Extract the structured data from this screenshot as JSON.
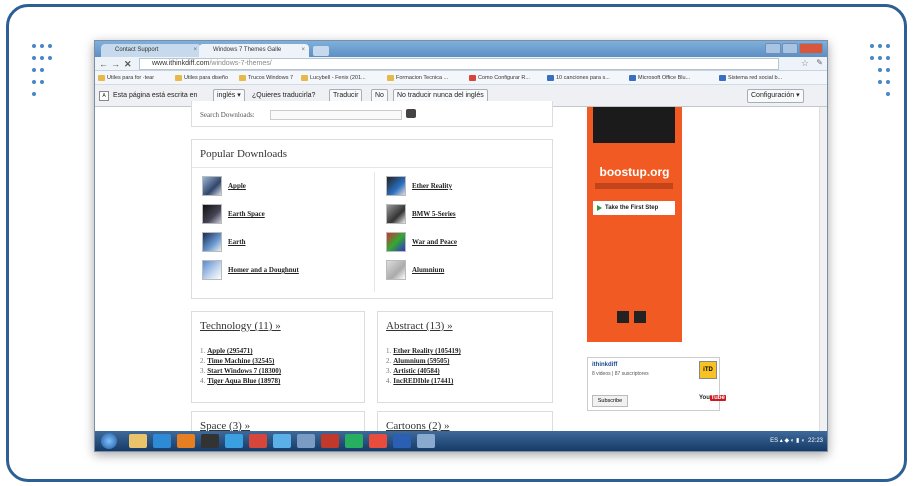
{
  "browser": {
    "tabs": [
      {
        "label": "Contact Support",
        "close": "×"
      },
      {
        "label": "Windows 7 Themes Galle",
        "close": "×"
      }
    ],
    "nav": {
      "back": "←",
      "forward": "→",
      "stop": "✕"
    },
    "url_host": "www.ithinkdiff.com",
    "url_path": "/windows-7-themes/",
    "bookmarks": [
      "Utiles para for ·tear",
      "Utiles para diseño",
      "Trucos Windows 7",
      "Lucybell - Fenix (201...",
      "Formacion Tecnica ...",
      "Como Configurar R...",
      "10 canciones para s...",
      "Microsoft Office Blu...",
      "Sistema red social b..."
    ],
    "translate_bar": {
      "text_prefix": "Esta página está escrita en",
      "language": "inglés ▾",
      "question": "¿Quieres traducirla?",
      "translate": "Traducir",
      "no": "No",
      "never": "No traducir nunca del inglés",
      "settings": "Configuración ▾"
    }
  },
  "page": {
    "search_label": "Search Downloads:",
    "popular_title": "Popular Downloads",
    "popular": [
      {
        "label": "Apple",
        "col": "left"
      },
      {
        "label": "Earth Space",
        "col": "left"
      },
      {
        "label": "Earth",
        "col": "left"
      },
      {
        "label": "Homer and a Doughnut",
        "col": "left"
      },
      {
        "label": "Ether Reality",
        "col": "right"
      },
      {
        "label": "BMW 5-Series",
        "col": "right"
      },
      {
        "label": "War and Peace",
        "col": "right"
      },
      {
        "label": "Alumnium",
        "col": "right"
      }
    ],
    "technology": {
      "title": "Technology (11) »",
      "items": [
        {
          "n": "1.",
          "label": "Apple (295471)"
        },
        {
          "n": "2.",
          "label": "Time Machine (32545)"
        },
        {
          "n": "3.",
          "label": "Start Windows 7 (18300)"
        },
        {
          "n": "4.",
          "label": "Tiger Aqua Blue (18978)"
        }
      ]
    },
    "abstract": {
      "title": "Abstract (13) »",
      "items": [
        {
          "n": "1.",
          "label": "Ether Reality (105419)"
        },
        {
          "n": "2.",
          "label": "Alumnium (59505)"
        },
        {
          "n": "3.",
          "label": "Artistic (40584)"
        },
        {
          "n": "4.",
          "label": "IncREDIble (17441)"
        }
      ]
    },
    "space_title": "Space (3) »",
    "cartoons_title": "Cartoons (2) »"
  },
  "ad": {
    "title": "boostup.org",
    "cta": "Take the First Step"
  },
  "youtube": {
    "name": "ithinkdiff",
    "meta": "8 videos | 87 suscriptores",
    "subscribe": "Subscribe",
    "avatar": "iTD",
    "logo_you": "You",
    "logo_tube": "Tube"
  },
  "taskbar": {
    "lang": "ES",
    "time": "22:23"
  },
  "colors": {
    "frame": "#2c5f93",
    "ad_orange": "#f15a22",
    "taskbar": "#163a66"
  }
}
